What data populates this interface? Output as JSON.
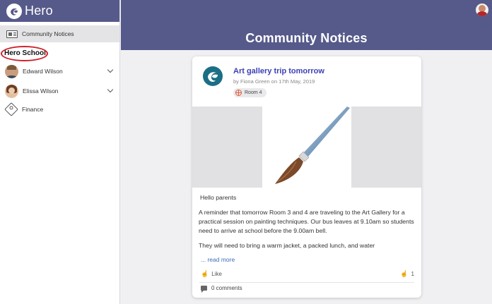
{
  "app": {
    "name": "Hero",
    "logo_icon": "hero-logo-icon"
  },
  "sidebar": {
    "active_item": {
      "label": "Community Notices",
      "icon": "notices-icon"
    },
    "school_name": "Hero School",
    "people": [
      {
        "name": "Edward Wilson",
        "icon": "chevron-down-icon"
      },
      {
        "name": "Elissa Wilson",
        "icon": "chevron-down-icon"
      }
    ],
    "finance": {
      "label": "Finance",
      "icon": "tag-icon"
    }
  },
  "header": {
    "title": "Community Notices"
  },
  "post": {
    "title": "Art gallery trip tomorrow",
    "meta": "by Fiona Green on 17th May, 2019",
    "room_tag": "Room 4",
    "image_icon": "paintbrush-icon",
    "greeting": "Hello parents",
    "paragraphs": [
      "A reminder that tomorrow Room 3 and 4 are traveling to the Art Gallery for a practical session on painting techniques. Our bus leaves at 9.10am so students need to arrive at school before the 9.00am bell.",
      "They will need to bring a warm jacket, a packed lunch, and water"
    ],
    "read_more": "... read more",
    "like_label": "Like",
    "like_count": "1",
    "comments": "0 comments"
  },
  "colors": {
    "header_bg": "#565a8a",
    "title_link": "#3b3fb5",
    "annotation_circle": "#d0202a"
  }
}
